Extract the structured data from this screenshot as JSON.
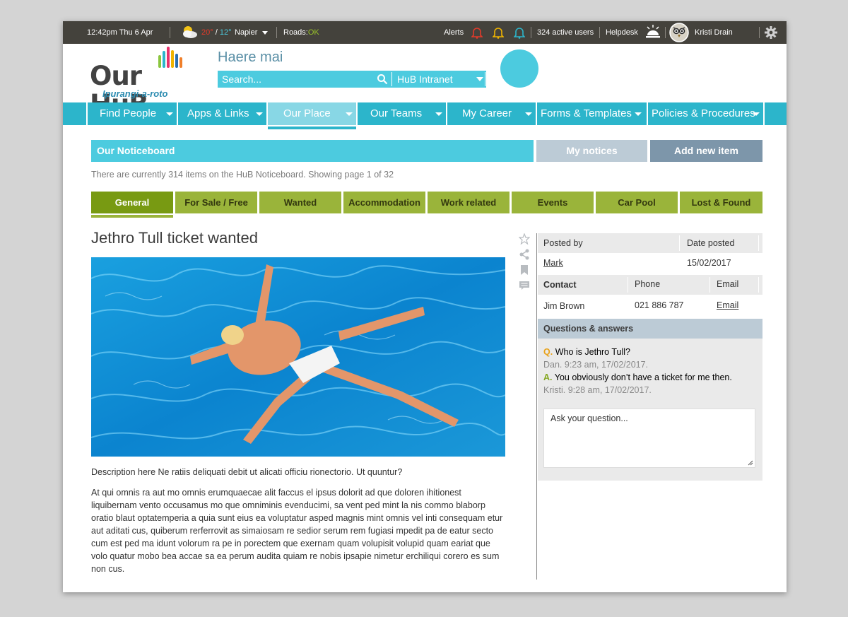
{
  "topbar": {
    "datetime": "12:42pm Thu 6 Apr",
    "temp_high": "20°",
    "temp_sep": "/",
    "temp_low": "12°",
    "location": "Napier",
    "roads_label": "Roads:",
    "roads_status": "OK",
    "alerts_label": "Alerts",
    "active_users": "324 active users",
    "helpdesk": "Helpdesk",
    "user_name": "Kristi Drain",
    "colors": {
      "bar_bg": "#44423c",
      "alert_red": "#e23a2a",
      "alert_yellow": "#f0b400",
      "alert_blue": "#2cb5cb",
      "ok_green": "#9ac22a"
    }
  },
  "header": {
    "logo_text": "Our HuB",
    "logo_sub": "Ipurangi-a-roto",
    "greeting": "Haere mai",
    "search_placeholder": "Search...",
    "search_scope": "HuB Intranet"
  },
  "nav": {
    "items": [
      {
        "label": "Find People"
      },
      {
        "label": "Apps & Links"
      },
      {
        "label": "Our Place",
        "active": true
      },
      {
        "label": "Our Teams"
      },
      {
        "label": "My Career"
      },
      {
        "label": "Forms & Templates"
      },
      {
        "label": "Policies & Procedures"
      }
    ],
    "color": "#2cb5cb",
    "active_color": "#88d7e5"
  },
  "noticeboard": {
    "title": "Our Noticeboard",
    "my_notices": "My notices",
    "add_new": "Add new item",
    "count_text": "There are currently 314 items on the HuB Noticeboard. Showing page 1 of 32",
    "categories": [
      "General",
      "For Sale / Free",
      "Wanted",
      "Accommodation",
      "Work related",
      "Events",
      "Car Pool",
      "Lost & Found"
    ],
    "active_category": "General"
  },
  "article": {
    "title": "Jethro Tull ticket wanted",
    "description": "Description here Ne ratiis deliquati debit ut alicati officiu rionectorio. Ut quuntur?",
    "body": "At qui omnis ra aut mo omnis erumquaecae alit faccus el ipsus dolorit ad que doloren ihitionest liquibernam vento occusamus mo que omniminis evenducimi, sa vent ped mint la nis commo blaborp oratio blaut optatemperia a quia sunt eius ea voluptatur asped magnis mint omnis vel inti consequam etur aut aditati cus, quiberum rerferrovit as simaiosam re sedior serum rem fugiasi mpedit pa de eatur secto cum est ped ma idunt volorum ra pe in porectem que exernam quam volupisit volupid quam eariat que volo quatur mobo bea accae sa ea perum audita quiam re nobis ipsapie nimetur erchiliqui corero es sum non cus."
  },
  "details": {
    "posted_by_label": "Posted by",
    "date_posted_label": "Date posted",
    "posted_by": "Mark",
    "date_posted": "15/02/2017",
    "contact_label": "Contact",
    "phone_label": "Phone",
    "email_label": "Email",
    "contact_name": "Jim Brown",
    "phone": "021 886 787",
    "email": "Email"
  },
  "qa": {
    "title": "Questions & answers",
    "q_prefix": "Q.",
    "question": "Who is Jethro Tull?",
    "question_meta": "Dan. 9:23 am, 17/02/2017.",
    "a_prefix": "A.",
    "answer": "You obviously don’t have a ticket for me then.",
    "answer_meta": "Kristi. 9:28 am, 17/02/2017.",
    "ask_placeholder": "Ask your question..."
  }
}
